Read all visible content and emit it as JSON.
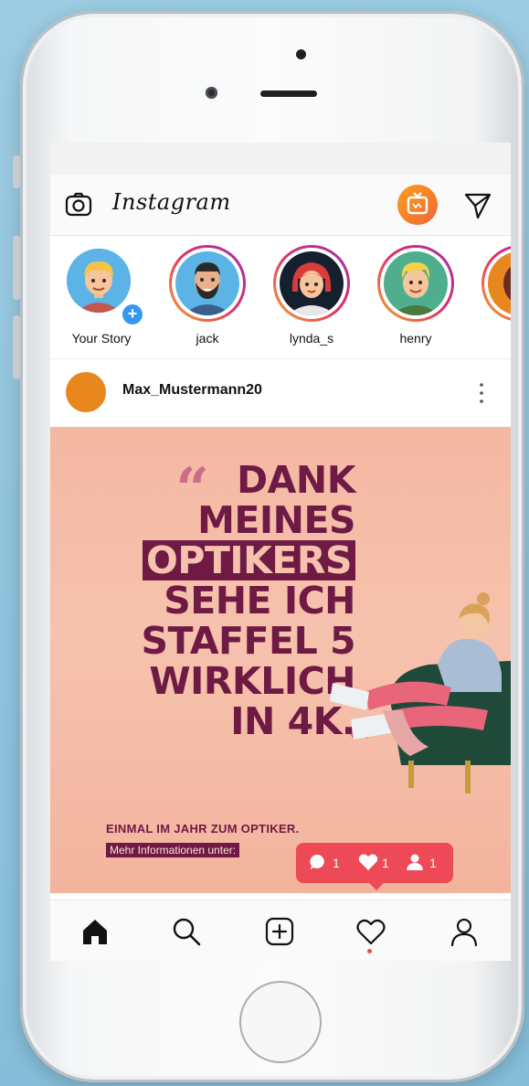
{
  "app": {
    "title": "Instagram"
  },
  "stories": [
    {
      "label": "Your Story"
    },
    {
      "label": "jack"
    },
    {
      "label": "lynda_s"
    },
    {
      "label": "henry"
    },
    {
      "label": ""
    }
  ],
  "post": {
    "username": "Max_Mustermann20",
    "ad": {
      "line1": "DANK",
      "line2": "MEINES",
      "line3": "OPTIKERS",
      "line4": "SEHE ICH",
      "line5": "STAFFEL 5",
      "line6": "WIRKLICH",
      "line7": "IN 4K.",
      "tagline": "EINMAL IM JAHR ZUM OPTIKER.",
      "info": "Mehr Informationen unter:"
    }
  },
  "notifications": {
    "comments": "1",
    "likes": "1",
    "follows": "1"
  },
  "colors": {
    "accent": "#ed4956",
    "ad_text": "#6e1a45",
    "brand_gradient_start": "#f5a623",
    "brand_gradient_end": "#9b2fae"
  },
  "icons": [
    "camera-icon",
    "igtv-icon",
    "direct-message-icon",
    "more-icon",
    "home-icon",
    "search-icon",
    "new-post-icon",
    "activity-heart-icon",
    "profile-icon"
  ]
}
